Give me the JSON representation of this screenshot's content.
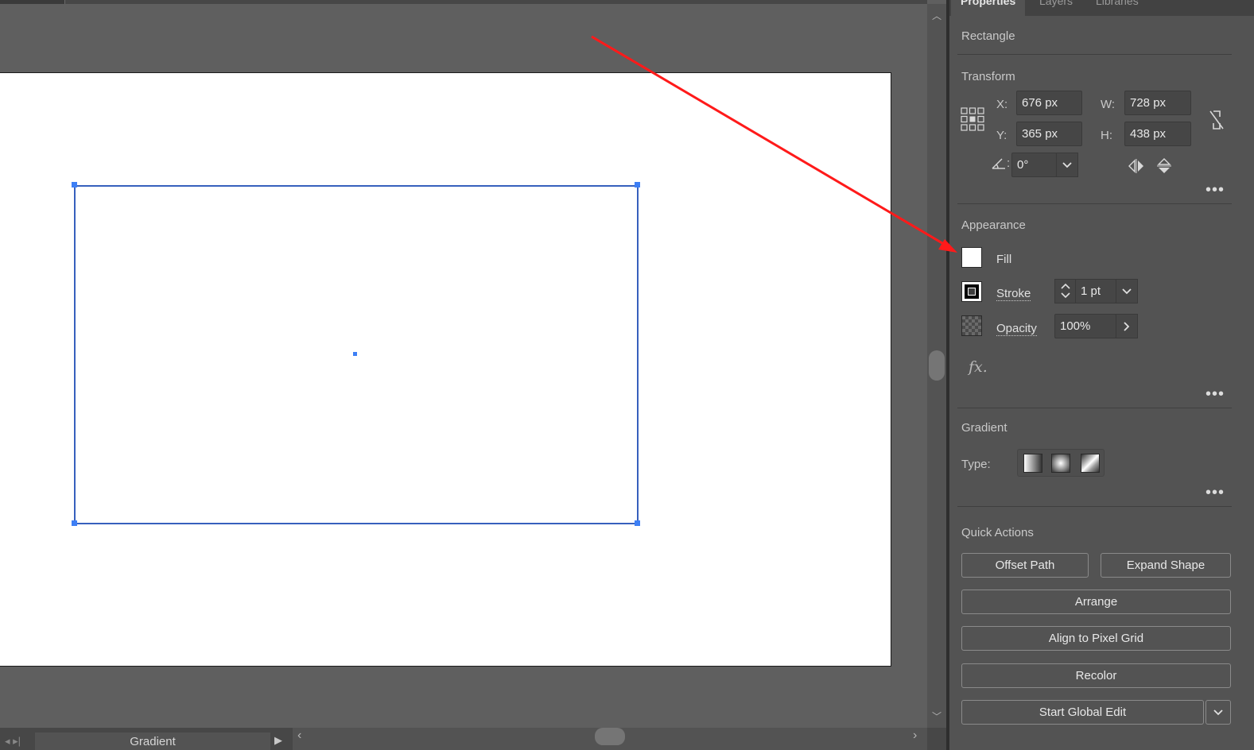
{
  "panel": {
    "tabs": [
      "Properties",
      "Layers",
      "Libraries"
    ],
    "object_type": "Rectangle",
    "transform": {
      "title": "Transform",
      "x_label": "X:",
      "x_value": "676 px",
      "y_label": "Y:",
      "y_value": "365 px",
      "w_label": "W:",
      "w_value": "728 px",
      "h_label": "H:",
      "h_value": "438 px",
      "angle_value": "0°"
    },
    "appearance": {
      "title": "Appearance",
      "fill_label": "Fill",
      "stroke_label": "Stroke",
      "stroke_value": "1 pt",
      "opacity_label": "Opacity",
      "opacity_value": "100%",
      "fx_label": "fx."
    },
    "gradient": {
      "title": "Gradient",
      "type_label": "Type:"
    },
    "quick_actions": {
      "title": "Quick Actions",
      "offset_path": "Offset Path",
      "expand_shape": "Expand Shape",
      "arrange": "Arrange",
      "align_pixel_grid": "Align to Pixel Grid",
      "recolor": "Recolor",
      "start_global_edit": "Start Global Edit"
    }
  },
  "status_bar": {
    "tool_label": "Gradient"
  },
  "colors": {
    "selection": "#3d7ff5",
    "annotation_arrow": "#ff1a1a",
    "panel_bg": "#535353",
    "canvas_bg": "#5f5f5f"
  }
}
